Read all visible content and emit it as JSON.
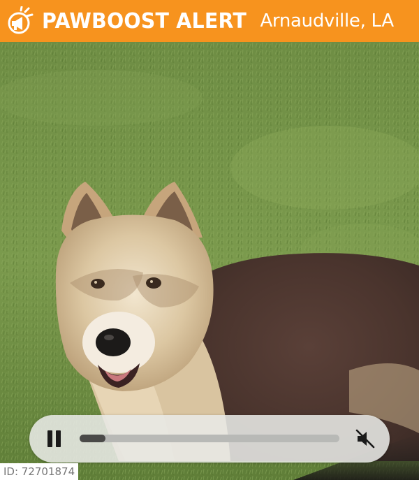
{
  "header": {
    "brand": "PAWBOOST ALERT",
    "location": "Arnaudville, LA",
    "logo_icon": "megaphone-icon",
    "background_color": "#f7931e",
    "text_color": "#ffffff"
  },
  "photo": {
    "subject": "dog"
  },
  "video_controls": {
    "play_state": "playing",
    "pause_icon": "pause-icon",
    "progress_fraction": 0.1,
    "muted": true,
    "volume_icon": "muted-speaker-icon"
  },
  "id_label": "ID: 72701874"
}
